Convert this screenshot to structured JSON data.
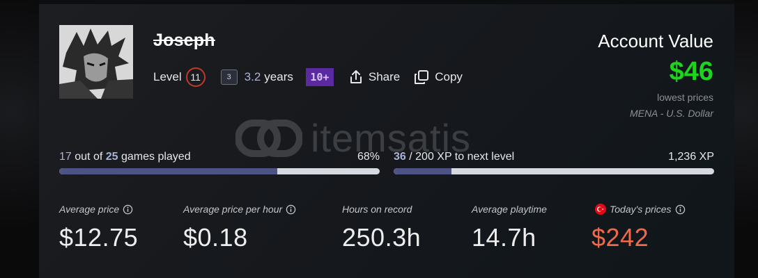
{
  "profile": {
    "username": "Joseph",
    "level_label": "Level",
    "level": "11",
    "years_icon_text": "3",
    "years_value": "3.2",
    "years_label": "years",
    "badge_text": "10+",
    "share_label": "Share",
    "copy_label": "Copy"
  },
  "account": {
    "title": "Account Value",
    "value": "$46",
    "subtitle": "lowest prices",
    "region": "MENA - U.S. Dollar",
    "value_color": "#1fd41f"
  },
  "watermark": {
    "text": "itemsatis"
  },
  "games_progress": {
    "played": "17",
    "out_of_text": "out of",
    "total": "25",
    "games_text": "games played",
    "percent_text": "68%",
    "fraction": 0.68
  },
  "xp_progress": {
    "current": "36",
    "rest_text": "/ 200 XP to next level",
    "total_xp": "1,236 XP",
    "fraction": 0.18
  },
  "stats": [
    {
      "label": "Average price",
      "value": "$12.75",
      "info": true
    },
    {
      "label": "Average price per hour",
      "value": "$0.18",
      "info": true
    },
    {
      "label": "Hours on record",
      "value": "250.3h",
      "info": false
    },
    {
      "label": "Average playtime",
      "value": "14.7h",
      "info": false
    },
    {
      "label": "Today's prices",
      "value": "$242",
      "info": true,
      "flag": "turkey-flag-icon",
      "color": "#f06a4a"
    }
  ],
  "icons": [
    "share-icon",
    "copy-icon",
    "info-icon",
    "turkey-flag-icon",
    "years-badge-icon"
  ]
}
